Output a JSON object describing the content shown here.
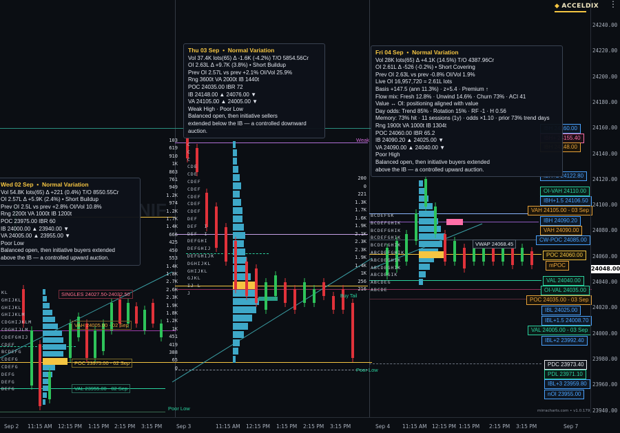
{
  "brand": {
    "name": "ACCELDIX",
    "menu_icon": "vertical-dots-icon"
  },
  "colors": {
    "background": "#0b0e13",
    "poc": "#f5c542",
    "vah": "#e8a33a",
    "val_green": "#2bd3a0",
    "ib": "#4aa3ff",
    "vwap": "#cfd6e2",
    "pink": "#ff6fa8",
    "cyan_profile": "#3ea8c8",
    "candle_up": "#2ec35a",
    "candle_down": "#e0323a"
  },
  "price_axis": {
    "labels": [
      "24240.00",
      "24220.00",
      "24200.00",
      "24180.00",
      "24160.00",
      "24140.00",
      "24120.00",
      "24100.00",
      "24080.00",
      "24060.00",
      "24040.00",
      "24020.00",
      "24000.00",
      "23980.00",
      "23960.00",
      "23940.00"
    ],
    "current_price": "24048.00"
  },
  "time_axis": {
    "labels": [
      "Sep 2",
      "11:15 AM",
      "12:15 PM",
      "1:15 PM",
      "2:15 PM",
      "3:15 PM",
      "Sep 3",
      "11:15 AM",
      "12:15 PM",
      "1:15 PM",
      "2:15 PM",
      "3:15 PM",
      "Sep 4",
      "11:15 AM",
      "12:15 PM",
      "1:15 PM",
      "2:15 PM",
      "3:15 PM",
      "Sep 7"
    ]
  },
  "sessions": {
    "sep2": {
      "header": "Wed 02 Sep",
      "variation": "Normal Variation",
      "lines": [
        "Vol 54.8K lots(65)   Δ +221 (0.4%)   T/O 8550.55Cr",
        "OI 2.57L   Δ +5.9K (2.4%)  •  Short Buildup",
        "Prev OI 2.5L   vs prev +2.8%   OI/Vol 10.8%",
        "Rng 2200t   VA 1000t   IB 1200t",
        "POC 23975.00   IBR 60",
        "IB  24000.00 ▲   23940.00 ▼",
        "VA  24005.00 ▲   23955.00 ▼",
        "Poor Low",
        "Balanced open, then initiative buyers extended",
        "above the IB — a controlled upward auction."
      ],
      "levels": {
        "singles": "SINGLES 24027.50-24032.50",
        "vah": "VAH 24005.00 - 02 Sep",
        "poc": "POC 23975.00 - 02 Sep",
        "val": "VAL 23955.00 - 02 Sep",
        "poor_low": "Poor Low"
      },
      "tpo_rows": [
        "KL",
        "GHIJKL",
        "GHIJKL",
        "GHIJKLM",
        "CDGHIJKLM",
        "CDGHIJLM",
        "CDEFGHIJ",
        "CDEF",
        "BCDEFG",
        "CDEFG",
        "CDEFG",
        "DEFG",
        "DEFG",
        "DEFG"
      ]
    },
    "sep3": {
      "header": "Thu 03 Sep",
      "variation": "Normal Variation",
      "lines": [
        "Vol 37.4K lots(65)   Δ -1.6K (-4.2%)   T/O 5854.56Cr",
        "OI 2.63L   Δ +9.7K (3.8%)  •  Short Buildup",
        "Prev OI 2.57L   vs prev +2.1%   OI/Vol 25.9%",
        "Rng 3600t   VA 2000t   IB 1440t",
        "POC 24035.00   IBR 72",
        "IB  24148.00 ▲   24076.00 ▼",
        "VA  24105.00 ▲   24005.00 ▼",
        "Weak High · Poor Low",
        "Balanced open, then initiative sellers",
        "extended below the IB — a controlled downward",
        "auction."
      ],
      "volumes": [
        "103",
        "619",
        "910",
        "1K",
        "863",
        "761",
        "949",
        "1.2K",
        "974",
        "1.2K",
        "1.7K",
        "1.4K",
        "666",
        "425",
        "450",
        "553",
        "1.4K",
        "1.8K",
        "2.7K",
        "2.6K",
        "2.3K",
        "1.9K",
        "1.8K",
        "1.2K",
        "1K",
        "451",
        "419",
        "388",
        "65",
        "0"
      ],
      "tpo_rows": [
        "C",
        "C",
        "C",
        "CDE",
        "CDE",
        "CDEF",
        "CDEF",
        "CDEF",
        "CDEF",
        "CDEF",
        "DEF",
        "DEF  I",
        "DEF  I",
        "DEFGHI",
        "DEFGHIJ",
        "DEFGHIJK",
        "DGHIJKL",
        "GHIJKL",
        "GJKL",
        "IJ L",
        "J",
        "",
        ""
      ],
      "levels": {
        "weak_high": "Weak",
        "poor_low": "Poor Low",
        "buy_tail": "Buy Tail"
      }
    },
    "sep4": {
      "header": "Fri 04 Sep",
      "variation": "Normal Variation",
      "lines": [
        "Vol 28K lots(65)   Δ +4.1K (14.5%)   T/O 4387.96Cr",
        "OI 2.61L   Δ -526 (-0.2%)  •  Short Covering",
        "Prev OI 2.63L   vs prev -0.8%   OI/Vol 1.9%",
        "Live OI 16,957,720  = 2.61L lots",
        "Basis +147.5 (ann 11.3%)  ·  z+5.4  ·  Premium ↑",
        "Flow mix: Fresh 12.8%  ·  Unwind 14.6%  ·  Churn 73%  ·  ACI 41",
        "Value ↔ OI: positioning aligned with value",
        "Day odds: Trend 85%  ·  Rotation 15%  ·  RF -1  ·  H 0.56",
        "Memory: 73% hit · 11 sessions (1y) · odds ×1.10 · prior 73% trend days",
        "Rng 1900t   VA 1000t   IB 1304t",
        "POC 24060.00   IBR 65.2",
        "IB  24090.20 ▲   24025.00 ▼",
        "VA  24090.00 ▲   24040.00 ▼",
        "Poor High",
        "Balanced open, then initiative buyers extended",
        "above the IB — a controlled upward auction."
      ],
      "volumes": [
        "200",
        "0",
        "221",
        "1.3K",
        "1.7K",
        "1.6K",
        "1.9K",
        "2.1K",
        "2.3K",
        "2.3K",
        "1.9K",
        "1.4K",
        "1K",
        "256",
        "216"
      ],
      "tpo_rows": [
        "BCDEFGK",
        "BCDEFGHIK",
        "BCDEFGHIK",
        "BCDEFGHIK",
        "BCDEFGHIK",
        "ABCDEFGHIK",
        "ABCDEGHIK",
        "ABCDEGHIK",
        "ABCDEGIK",
        "ABCDEG",
        "ABCDE"
      ],
      "vwap": "VWAP 24068.45"
    }
  },
  "right_levels": [
    "IBH 24160.00",
    "IBH+ 24155.40",
    "IBH 24148.00",
    "IBH+2 24122.80",
    "OI-VAH 24110.00",
    "IBH+1.5 24106.50",
    "VAH 24105.00 - 03 Sep",
    "IBH 24090.20",
    "VAH 24090.00",
    "CW-POC 24085.00",
    "POC 24060.00",
    "mPOC",
    "VAL 24040.00",
    "OI-VAL 24035.00",
    "POC 24035.00 - 03 Sep",
    "IBL 24025.00",
    "IBL+1.5 24008.70",
    "VAL 24005.00 - 03 Sep",
    "IBL+2 23992.40",
    "PDC 23973.40",
    "PDL 23971.10",
    "IBL+3 23959.80",
    "nOI 23955.00"
  ],
  "footer": {
    "credit": "mirracharts.com • v1.0.179"
  },
  "watermark": "NIF"
}
